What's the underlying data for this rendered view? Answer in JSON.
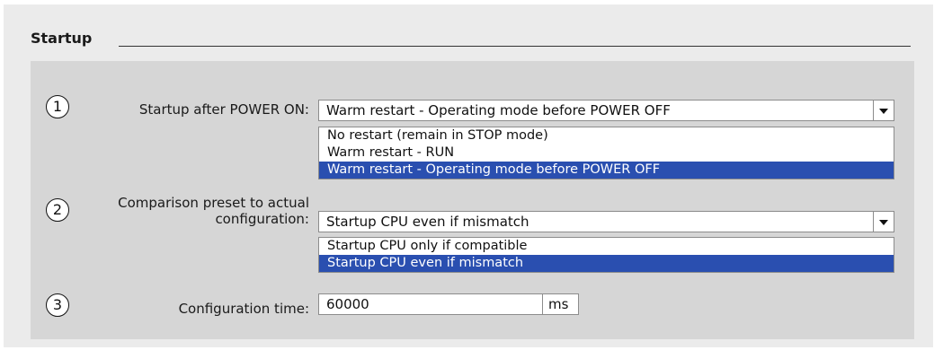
{
  "section": {
    "title": "Startup"
  },
  "rows": [
    {
      "number": "1",
      "label": "Startup after POWER ON:",
      "selected": "Warm restart - Operating mode before POWER OFF",
      "options": [
        "No restart (remain in STOP mode)",
        "Warm restart - RUN",
        "Warm restart - Operating mode before POWER OFF"
      ],
      "selected_index": 2
    },
    {
      "number": "2",
      "label_line1": "Comparison preset to actual",
      "label_line2": "configuration:",
      "selected": "Startup CPU even if mismatch",
      "options": [
        "Startup CPU only if compatible",
        "Startup CPU even if mismatch"
      ],
      "selected_index": 1
    },
    {
      "number": "3",
      "label": "Configuration time:",
      "value": "60000",
      "unit": "ms"
    }
  ],
  "icons": {
    "dropdown": "chevron-down-icon"
  },
  "colors": {
    "selection": "#2a4fb0",
    "panel": "#d6d6d6",
    "background": "#ebebeb"
  }
}
